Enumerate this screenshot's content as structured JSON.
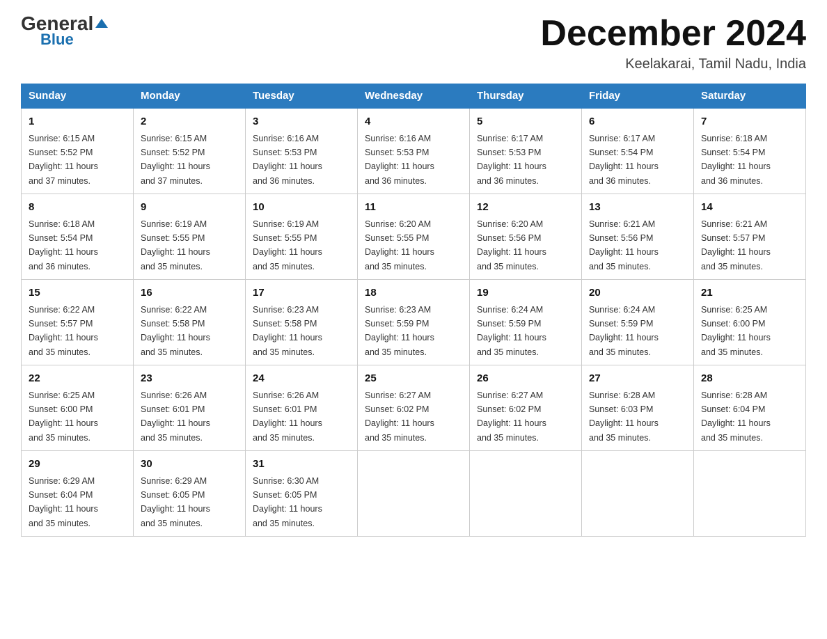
{
  "logo": {
    "general": "General",
    "blue": "Blue",
    "triangle": "▲"
  },
  "title": "December 2024",
  "location": "Keelakarai, Tamil Nadu, India",
  "days_of_week": [
    "Sunday",
    "Monday",
    "Tuesday",
    "Wednesday",
    "Thursday",
    "Friday",
    "Saturday"
  ],
  "weeks": [
    [
      {
        "day": "1",
        "sunrise": "6:15 AM",
        "sunset": "5:52 PM",
        "daylight": "11 hours and 37 minutes."
      },
      {
        "day": "2",
        "sunrise": "6:15 AM",
        "sunset": "5:52 PM",
        "daylight": "11 hours and 37 minutes."
      },
      {
        "day": "3",
        "sunrise": "6:16 AM",
        "sunset": "5:53 PM",
        "daylight": "11 hours and 36 minutes."
      },
      {
        "day": "4",
        "sunrise": "6:16 AM",
        "sunset": "5:53 PM",
        "daylight": "11 hours and 36 minutes."
      },
      {
        "day": "5",
        "sunrise": "6:17 AM",
        "sunset": "5:53 PM",
        "daylight": "11 hours and 36 minutes."
      },
      {
        "day": "6",
        "sunrise": "6:17 AM",
        "sunset": "5:54 PM",
        "daylight": "11 hours and 36 minutes."
      },
      {
        "day": "7",
        "sunrise": "6:18 AM",
        "sunset": "5:54 PM",
        "daylight": "11 hours and 36 minutes."
      }
    ],
    [
      {
        "day": "8",
        "sunrise": "6:18 AM",
        "sunset": "5:54 PM",
        "daylight": "11 hours and 36 minutes."
      },
      {
        "day": "9",
        "sunrise": "6:19 AM",
        "sunset": "5:55 PM",
        "daylight": "11 hours and 35 minutes."
      },
      {
        "day": "10",
        "sunrise": "6:19 AM",
        "sunset": "5:55 PM",
        "daylight": "11 hours and 35 minutes."
      },
      {
        "day": "11",
        "sunrise": "6:20 AM",
        "sunset": "5:55 PM",
        "daylight": "11 hours and 35 minutes."
      },
      {
        "day": "12",
        "sunrise": "6:20 AM",
        "sunset": "5:56 PM",
        "daylight": "11 hours and 35 minutes."
      },
      {
        "day": "13",
        "sunrise": "6:21 AM",
        "sunset": "5:56 PM",
        "daylight": "11 hours and 35 minutes."
      },
      {
        "day": "14",
        "sunrise": "6:21 AM",
        "sunset": "5:57 PM",
        "daylight": "11 hours and 35 minutes."
      }
    ],
    [
      {
        "day": "15",
        "sunrise": "6:22 AM",
        "sunset": "5:57 PM",
        "daylight": "11 hours and 35 minutes."
      },
      {
        "day": "16",
        "sunrise": "6:22 AM",
        "sunset": "5:58 PM",
        "daylight": "11 hours and 35 minutes."
      },
      {
        "day": "17",
        "sunrise": "6:23 AM",
        "sunset": "5:58 PM",
        "daylight": "11 hours and 35 minutes."
      },
      {
        "day": "18",
        "sunrise": "6:23 AM",
        "sunset": "5:59 PM",
        "daylight": "11 hours and 35 minutes."
      },
      {
        "day": "19",
        "sunrise": "6:24 AM",
        "sunset": "5:59 PM",
        "daylight": "11 hours and 35 minutes."
      },
      {
        "day": "20",
        "sunrise": "6:24 AM",
        "sunset": "5:59 PM",
        "daylight": "11 hours and 35 minutes."
      },
      {
        "day": "21",
        "sunrise": "6:25 AM",
        "sunset": "6:00 PM",
        "daylight": "11 hours and 35 minutes."
      }
    ],
    [
      {
        "day": "22",
        "sunrise": "6:25 AM",
        "sunset": "6:00 PM",
        "daylight": "11 hours and 35 minutes."
      },
      {
        "day": "23",
        "sunrise": "6:26 AM",
        "sunset": "6:01 PM",
        "daylight": "11 hours and 35 minutes."
      },
      {
        "day": "24",
        "sunrise": "6:26 AM",
        "sunset": "6:01 PM",
        "daylight": "11 hours and 35 minutes."
      },
      {
        "day": "25",
        "sunrise": "6:27 AM",
        "sunset": "6:02 PM",
        "daylight": "11 hours and 35 minutes."
      },
      {
        "day": "26",
        "sunrise": "6:27 AM",
        "sunset": "6:02 PM",
        "daylight": "11 hours and 35 minutes."
      },
      {
        "day": "27",
        "sunrise": "6:28 AM",
        "sunset": "6:03 PM",
        "daylight": "11 hours and 35 minutes."
      },
      {
        "day": "28",
        "sunrise": "6:28 AM",
        "sunset": "6:04 PM",
        "daylight": "11 hours and 35 minutes."
      }
    ],
    [
      {
        "day": "29",
        "sunrise": "6:29 AM",
        "sunset": "6:04 PM",
        "daylight": "11 hours and 35 minutes."
      },
      {
        "day": "30",
        "sunrise": "6:29 AM",
        "sunset": "6:05 PM",
        "daylight": "11 hours and 35 minutes."
      },
      {
        "day": "31",
        "sunrise": "6:30 AM",
        "sunset": "6:05 PM",
        "daylight": "11 hours and 35 minutes."
      },
      null,
      null,
      null,
      null
    ]
  ],
  "labels": {
    "sunrise": "Sunrise:",
    "sunset": "Sunset:",
    "daylight": "Daylight:"
  }
}
